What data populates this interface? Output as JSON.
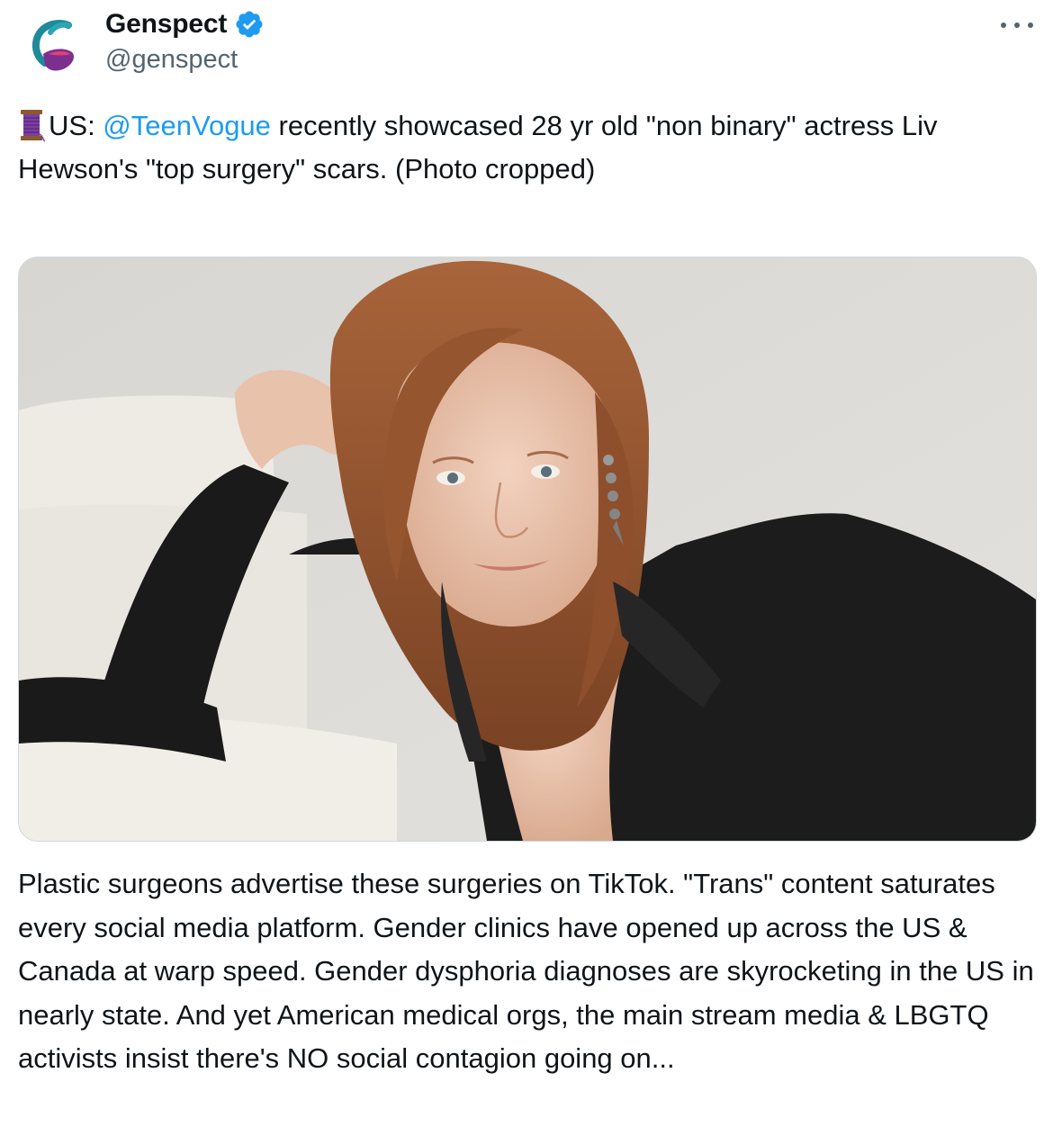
{
  "author": {
    "display_name": "Genspect",
    "handle": "@genspect",
    "verified": true,
    "avatar_icon": "genspect-logo"
  },
  "menu": {
    "more_icon": "more-options-icon"
  },
  "tweet": {
    "emoji": "thread-spool",
    "prefix": "US: ",
    "mention": "@TeenVogue",
    "text_after_mention": " recently showcased 28 yr old \"non binary\" actress Liv Hewson's \"top surgery\" scars. (Photo cropped)",
    "paragraph_2": "Plastic surgeons advertise these surgeries on TikTok. \"Trans\" content saturates every social media platform. Gender clinics have opened up across the US & Canada at warp speed. Gender dysphoria diagnoses are skyrocketing in the US in nearly state. And yet American medical orgs, the main stream media & LBGTQ activists insist there's NO social contagion going on..."
  },
  "colors": {
    "link": "#1d9bf0",
    "verified_badge": "#1d9bf0",
    "secondary_text": "#536471",
    "primary_text": "#0f1419"
  }
}
